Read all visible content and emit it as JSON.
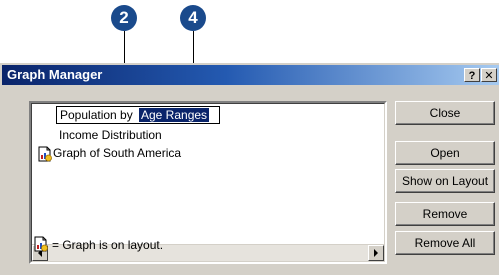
{
  "callouts": [
    "2",
    "4"
  ],
  "dialog": {
    "title": "Graph Manager",
    "help_label": "?",
    "close_label": "✕"
  },
  "list": {
    "editing_prefix": "Population by",
    "editing_selected": "Age Ranges",
    "items": [
      {
        "label": "Income Distribution",
        "on_layout": false
      },
      {
        "label": "Graph of South America",
        "on_layout": true
      }
    ]
  },
  "legend": {
    "text": "= Graph is on layout."
  },
  "buttons": {
    "close": "Close",
    "open": "Open",
    "show_on_layout": "Show on Layout",
    "remove": "Remove",
    "remove_all": "Remove All"
  },
  "icons": {
    "graph_on_layout": "graph-on-layout-icon"
  },
  "colors": {
    "title_bar": "#0a246a",
    "selection": "#0a246a",
    "callout": "#1a4a8c",
    "dialog_face": "#d4d0c8"
  }
}
